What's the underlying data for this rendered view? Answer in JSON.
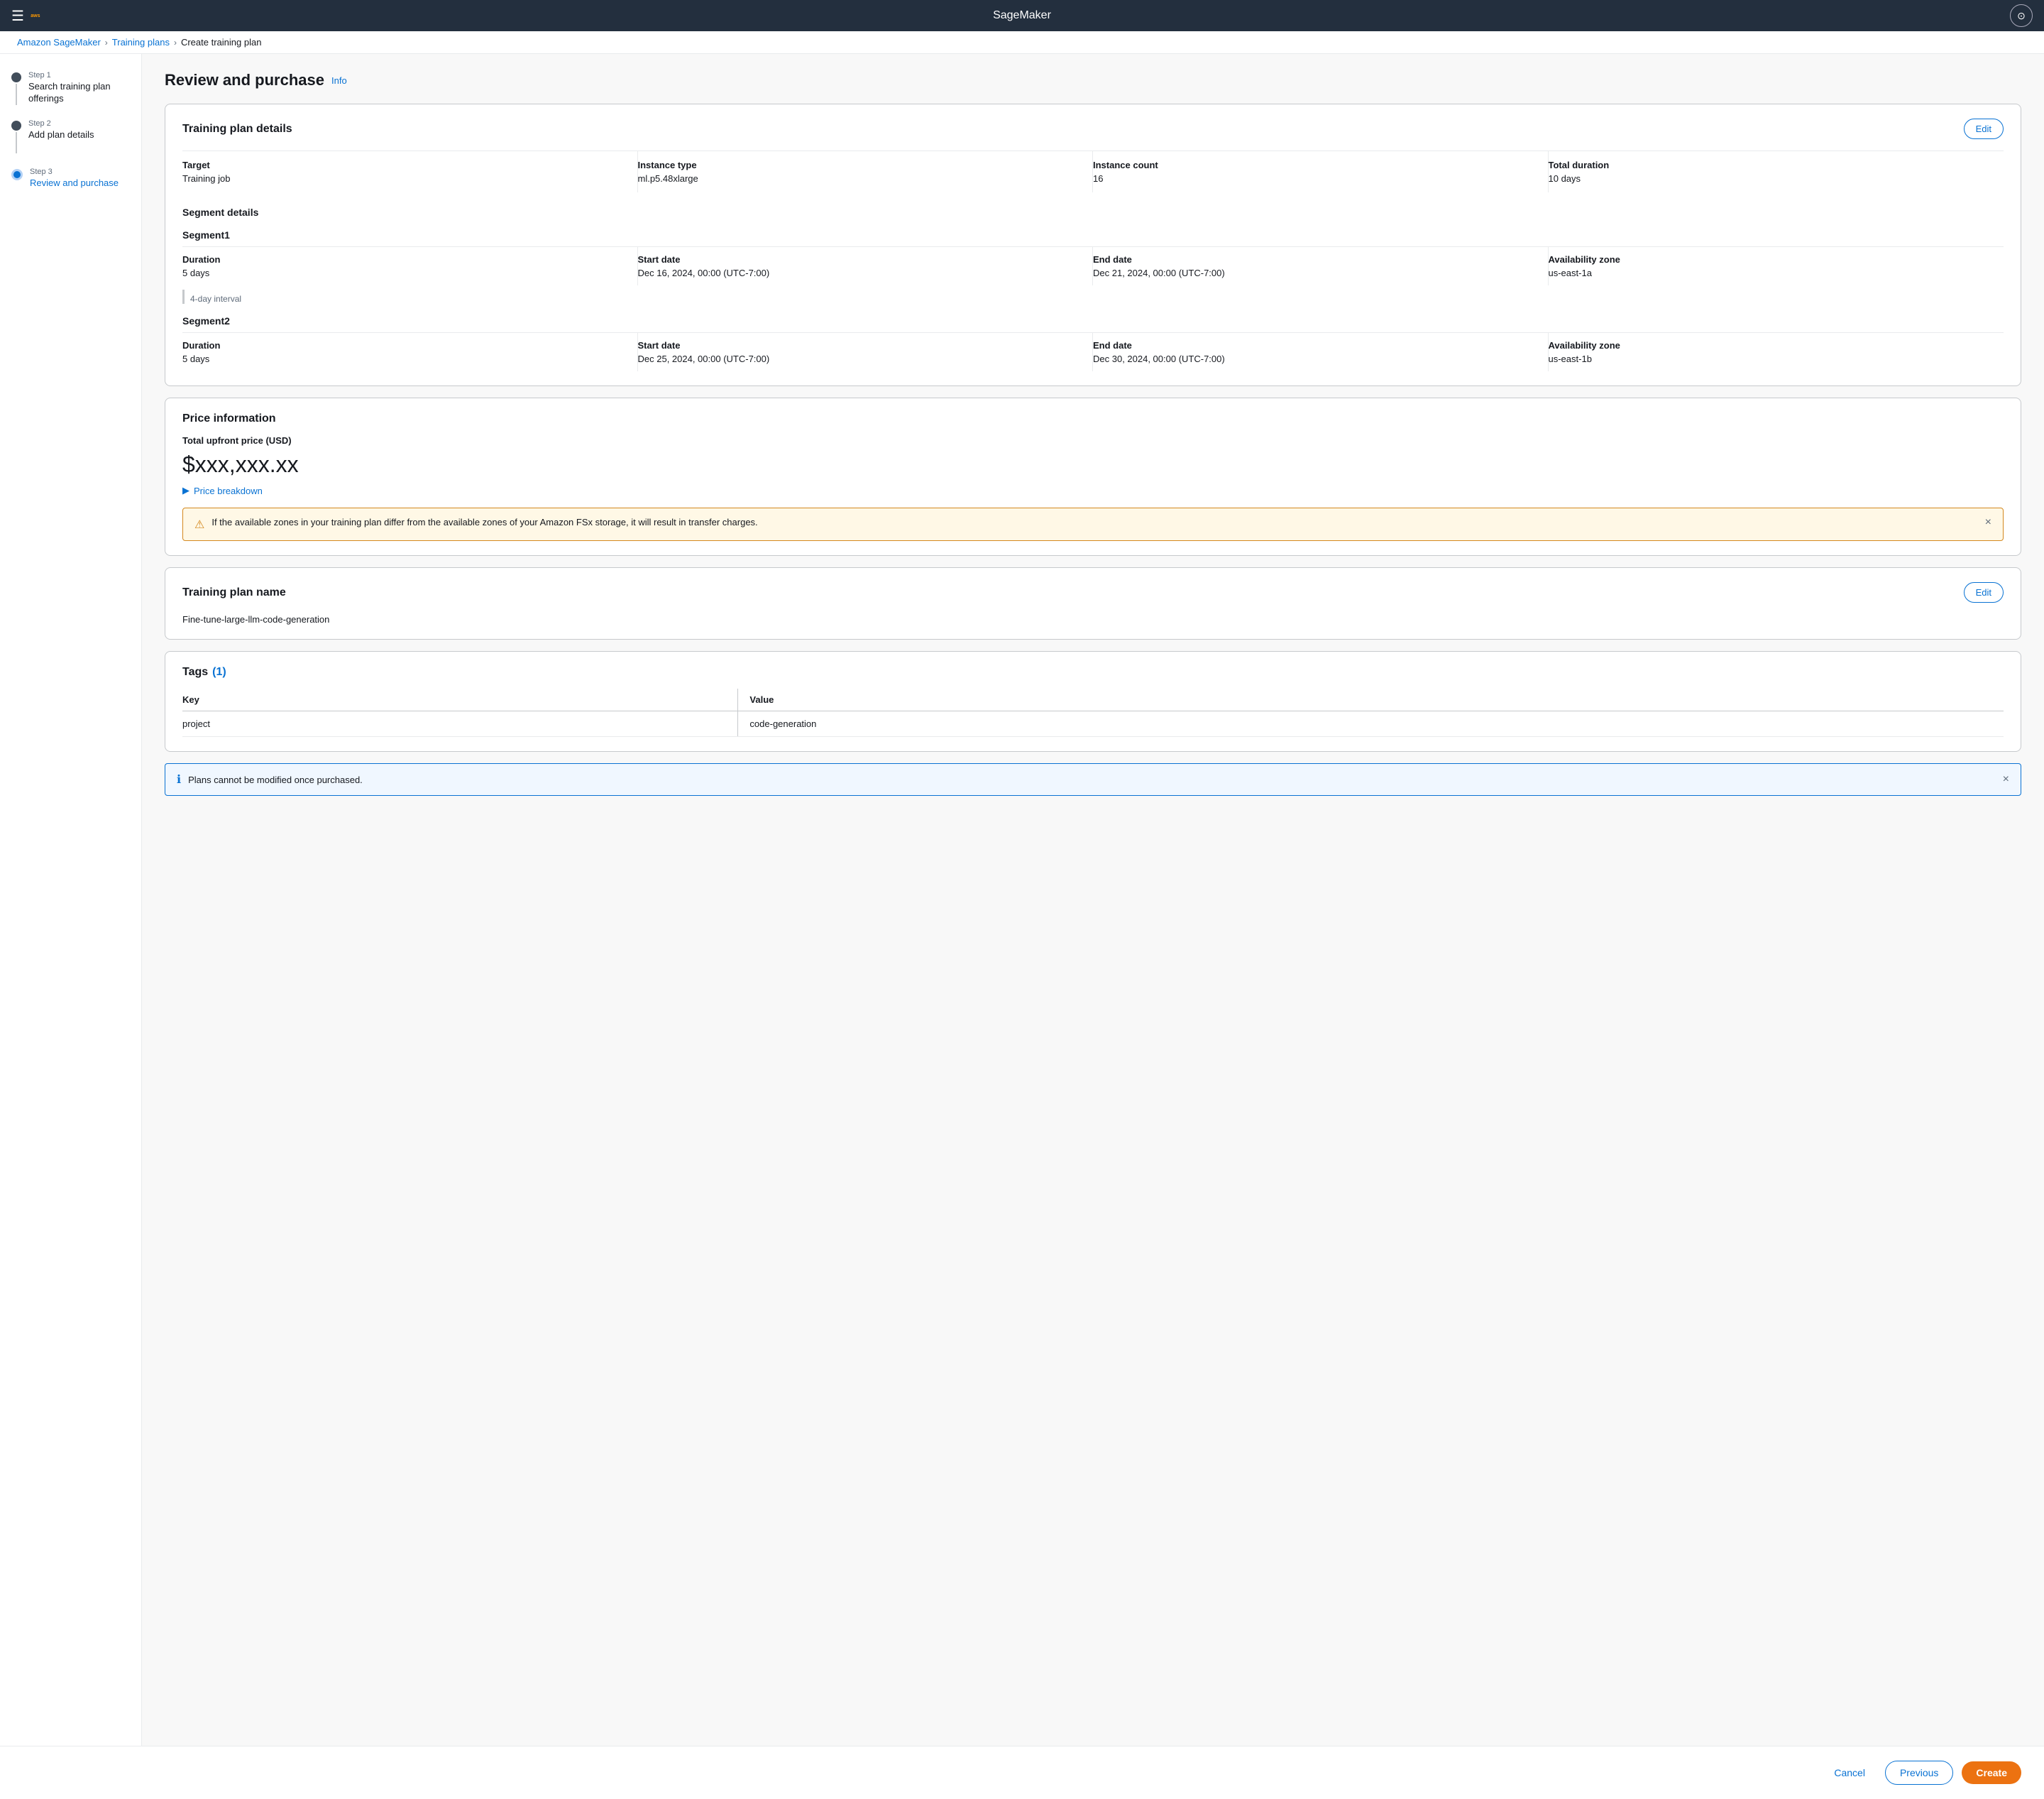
{
  "app": {
    "title": "SageMaker"
  },
  "topnav": {
    "menu_label": "☰",
    "account_label": "⊙"
  },
  "breadcrumb": {
    "root": "Amazon SageMaker",
    "parent": "Training plans",
    "current": "Create training plan",
    "sep": "›"
  },
  "steps": [
    {
      "id": "step1",
      "number": "Step 1",
      "label": "Search training plan offerings",
      "state": "completed"
    },
    {
      "id": "step2",
      "number": "Step 2",
      "label": "Add plan details",
      "state": "completed"
    },
    {
      "id": "step3",
      "number": "Step 3",
      "label": "Review and purchase",
      "state": "active"
    }
  ],
  "page": {
    "title": "Review and purchase",
    "info_link": "Info"
  },
  "training_plan_details": {
    "card_title": "Training plan details",
    "edit_label": "Edit",
    "fields": [
      {
        "label": "Target",
        "value": "Training job"
      },
      {
        "label": "Instance type",
        "value": "ml.p5.48xlarge"
      },
      {
        "label": "Instance count",
        "value": "16"
      },
      {
        "label": "Total duration",
        "value": "10 days"
      }
    ],
    "segment_section_title": "Segment details",
    "segments": [
      {
        "name": "Segment1",
        "fields": [
          {
            "label": "Duration",
            "value": "5 days"
          },
          {
            "label": "Start date",
            "value": "Dec 16, 2024, 00:00 (UTC-7:00)"
          },
          {
            "label": "End date",
            "value": "Dec 21, 2024, 00:00 (UTC-7:00)"
          },
          {
            "label": "Availability zone",
            "value": "us-east-1a"
          }
        ],
        "interval_note": "4-day interval"
      },
      {
        "name": "Segment2",
        "fields": [
          {
            "label": "Duration",
            "value": "5 days"
          },
          {
            "label": "Start date",
            "value": "Dec 25, 2024, 00:00 (UTC-7:00)"
          },
          {
            "label": "End date",
            "value": "Dec 30, 2024, 00:00 (UTC-7:00)"
          },
          {
            "label": "Availability zone",
            "value": "us-east-1b"
          }
        ],
        "interval_note": null
      }
    ]
  },
  "price_information": {
    "card_title": "Price information",
    "total_label": "Total upfront price (USD)",
    "amount": "$xxx,xxx.xx",
    "breakdown_label": "Price breakdown",
    "warning_text": "If the available zones in your training plan differ from the available zones of your Amazon FSx storage, it will result in transfer charges."
  },
  "training_plan_name": {
    "card_title": "Training plan name",
    "edit_label": "Edit",
    "name_value": "Fine-tune-large-llm-code-generation"
  },
  "tags": {
    "card_title": "Tags",
    "count": "(1)",
    "col_key": "Key",
    "col_value": "Value",
    "rows": [
      {
        "key": "project",
        "value": "code-generation"
      }
    ]
  },
  "info_alert": {
    "text": "Plans cannot be modified once purchased."
  },
  "footer": {
    "cancel_label": "Cancel",
    "previous_label": "Previous",
    "create_label": "Create"
  }
}
